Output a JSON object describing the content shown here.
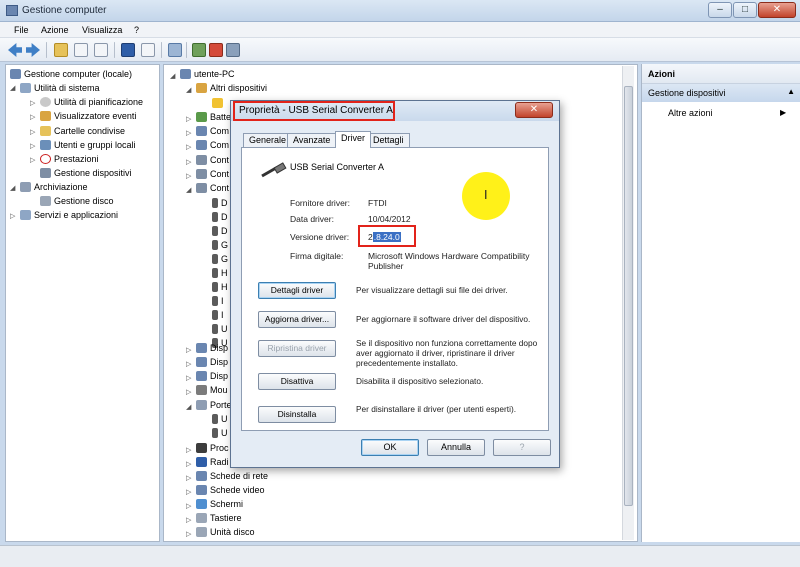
{
  "window": {
    "title": "Gestione computer",
    "controls": {
      "minimize": "–",
      "maximize": "□",
      "close": "✕"
    }
  },
  "menu": {
    "file": "File",
    "azione": "Azione",
    "visualizza": "Visualizza",
    "help": "?"
  },
  "left_tree": {
    "root": "Gestione computer (locale)",
    "utilita": "Utilità di sistema",
    "pianificazione": "Utilità di pianificazione",
    "eventi": "Visualizzatore eventi",
    "cartelle": "Cartelle condivise",
    "utenti": "Utenti e gruppi locali",
    "prestazioni": "Prestazioni",
    "gestione_dispositivi": "Gestione dispositivi",
    "archiviazione": "Archiviazione",
    "gestione_disco": "Gestione disco",
    "servizi": "Servizi e applicazioni"
  },
  "device_tree": {
    "computer": "utente-PC",
    "altri": "Altri dispositivi",
    "batterie": "Batte",
    "com1": "Com",
    "com2": "Com",
    "cont1": "Cont",
    "cont2": "Cont",
    "cont3": "Cont",
    "sub_d1": "D",
    "sub_d2": "D",
    "sub_d3": "D",
    "sub_g1": "G",
    "sub_g2": "G",
    "sub_h1": "H",
    "sub_h2": "H",
    "sub_i1": "I",
    "sub_i2": "I",
    "sub_u1": "U",
    "sub_u2": "U",
    "disp1": "Disp",
    "disp2": "Disp",
    "disp3": "Disp",
    "mouse": "Mou",
    "porte": "Porte",
    "porte_u1": "U",
    "porte_u2": "U",
    "proc": "Proc",
    "radio": "Radi",
    "rete": "Schede di rete",
    "video": "Schede video",
    "schermi": "Schermi",
    "tastiere": "Tastiere",
    "unita_disco": "Unità disco"
  },
  "actions": {
    "header": "Azioni",
    "section": "Gestione dispositivi",
    "more": "Altre azioni"
  },
  "dialog": {
    "title": "Proprietà - USB Serial Converter A",
    "close": "✕",
    "tabs": [
      "Generale",
      "Avanzate",
      "Driver",
      "Dettagli"
    ],
    "device_name": "USB Serial Converter A",
    "fornitore_label": "Fornitore driver:",
    "fornitore_value": "FTDI",
    "data_label": "Data driver:",
    "data_value": "10/04/2012",
    "versione_label": "Versione driver:",
    "versione_value_prefix": "2",
    "versione_value_selected": ".8.24.0",
    "firma_label": "Firma digitale:",
    "firma_value": "Microsoft Windows Hardware Compatibility Publisher",
    "buttons": {
      "dettagli": {
        "label": "Dettagli driver",
        "desc": "Per visualizzare dettagli sui file dei driver."
      },
      "aggiorna": {
        "label": "Aggiorna driver...",
        "desc": "Per aggiornare il software driver del dispositivo."
      },
      "ripristina": {
        "label": "Ripristina driver",
        "desc": "Se il dispositivo non funziona correttamente dopo aver aggiornato il driver, ripristinare il driver precedentemente installato."
      },
      "disattiva": {
        "label": "Disattiva",
        "desc": "Disabilita il dispositivo selezionato."
      },
      "disinstalla": {
        "label": "Disinstalla",
        "desc": "Per disinstallare il driver (per utenti esperti)."
      }
    },
    "ok": "OK",
    "annulla": "Annulla",
    "help": "?"
  },
  "cursor_glyph": "I",
  "colors": {
    "highlight_box": "#e2231a",
    "selection": "#3a6fc4",
    "cursor_spot": "#fff000"
  }
}
